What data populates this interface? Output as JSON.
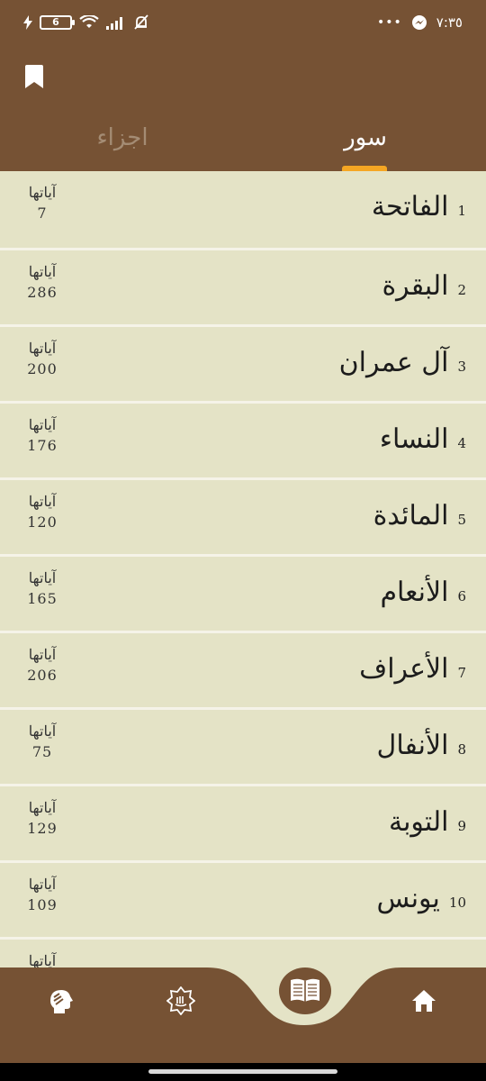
{
  "status_bar": {
    "battery": "6",
    "time": "٧:٣٥",
    "overflow": "•••"
  },
  "header": {
    "tabs": [
      {
        "label": "سور",
        "active": true
      },
      {
        "label": "اجزاء",
        "active": false
      }
    ],
    "accent": "#f5a623",
    "brand": "#765234"
  },
  "ayat_label": "آياتها",
  "surahs": [
    {
      "num": "1",
      "name": "الفاتحة",
      "ayat": "7"
    },
    {
      "num": "2",
      "name": "البقرة",
      "ayat": "286"
    },
    {
      "num": "3",
      "name": "آل عمران",
      "ayat": "200"
    },
    {
      "num": "4",
      "name": "النساء",
      "ayat": "176"
    },
    {
      "num": "5",
      "name": "المائدة",
      "ayat": "120"
    },
    {
      "num": "6",
      "name": "الأنعام",
      "ayat": "165"
    },
    {
      "num": "7",
      "name": "الأعراف",
      "ayat": "206"
    },
    {
      "num": "8",
      "name": "الأنفال",
      "ayat": "75"
    },
    {
      "num": "9",
      "name": "التوبة",
      "ayat": "129"
    },
    {
      "num": "10",
      "name": "يونس",
      "ayat": "109"
    },
    {
      "num": "",
      "name": "",
      "ayat": ""
    }
  ],
  "bottom_nav": {
    "items": [
      {
        "icon": "talking-head-icon"
      },
      {
        "icon": "allah-emblem-icon"
      },
      {
        "icon": "quran-book-icon"
      },
      {
        "icon": "home-icon"
      }
    ]
  }
}
